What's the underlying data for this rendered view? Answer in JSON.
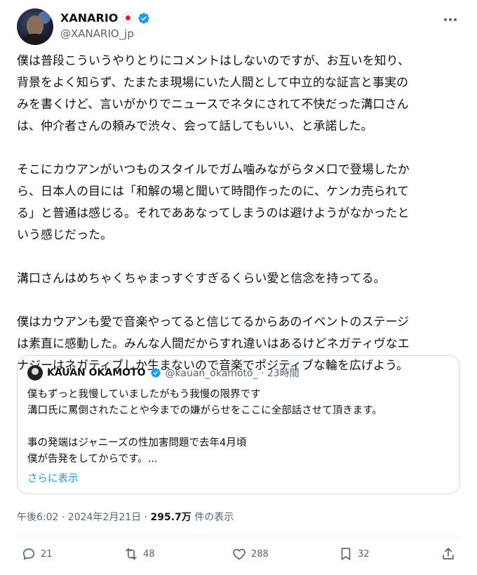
{
  "author": {
    "display_name": "XANARIO",
    "handle": "@XANARIO_jp"
  },
  "body": "僕は普段こういうやりとりにコメントはしないのですが、お互いを知り、\n背景をよく知らず、たまたま現場にいた人間として中立的な証言と事実の\nみを書くけど、言いがかりでニュースでネタにされて不快だった溝口さん\nは、仲介者さんの頼みで渋々、会って話してもいい、と承諾した。\n\nそこにカウアンがいつものスタイルでガム噛みながらタメ口で登場したか\nら、日本人の目には「和解の場と聞いて時間作ったのに、ケンカ売られて\nる」と普通は感じる。それでああなってしまうのは避けようがなかったと\nいう感じだった。\n\n溝口さんはめちゃくちゃまっすぐすぎるくらい愛と信念を持ってる。\n\n僕はカウアンも愛で音楽やってると信じてるからあのイベントのステージ\nは素直に感動した。みんな人間だからすれ違いはあるけどネガティヴなエ\nナジーはネガティブしか生まないので音楽でポジティブな輪を広げよう。",
  "quote": {
    "name": "KAUAN OKAMOTO",
    "handle_time": "@kauan_okamoto_ · 23時間",
    "text": "僕もずっと我慢していましたがもう我慢の限界です\n溝口氏に罵倒されたことや今までの嫌がらせをここに全部話させて頂きます。\n\n事の発端はジャニーズの性加害問題で去年4月頃\n僕が告発をしてからです。...",
    "show_more": "さらに表示"
  },
  "meta": {
    "timestamp": "午後6:02 · 2024年2月21日 · ",
    "views": "295.7万",
    "views_suffix": " 件の表示"
  },
  "actions": {
    "replies": "21",
    "reposts": "48",
    "likes": "288",
    "bookmarks": "32"
  },
  "colors": {
    "accent": "#1d9bf0",
    "secondary_text": "#536471",
    "border": "#cfd9de"
  },
  "icons": [
    "verified-icon",
    "flag-icon",
    "more-icon",
    "reply-icon",
    "repost-icon",
    "like-icon",
    "bookmark-icon",
    "share-icon"
  ]
}
